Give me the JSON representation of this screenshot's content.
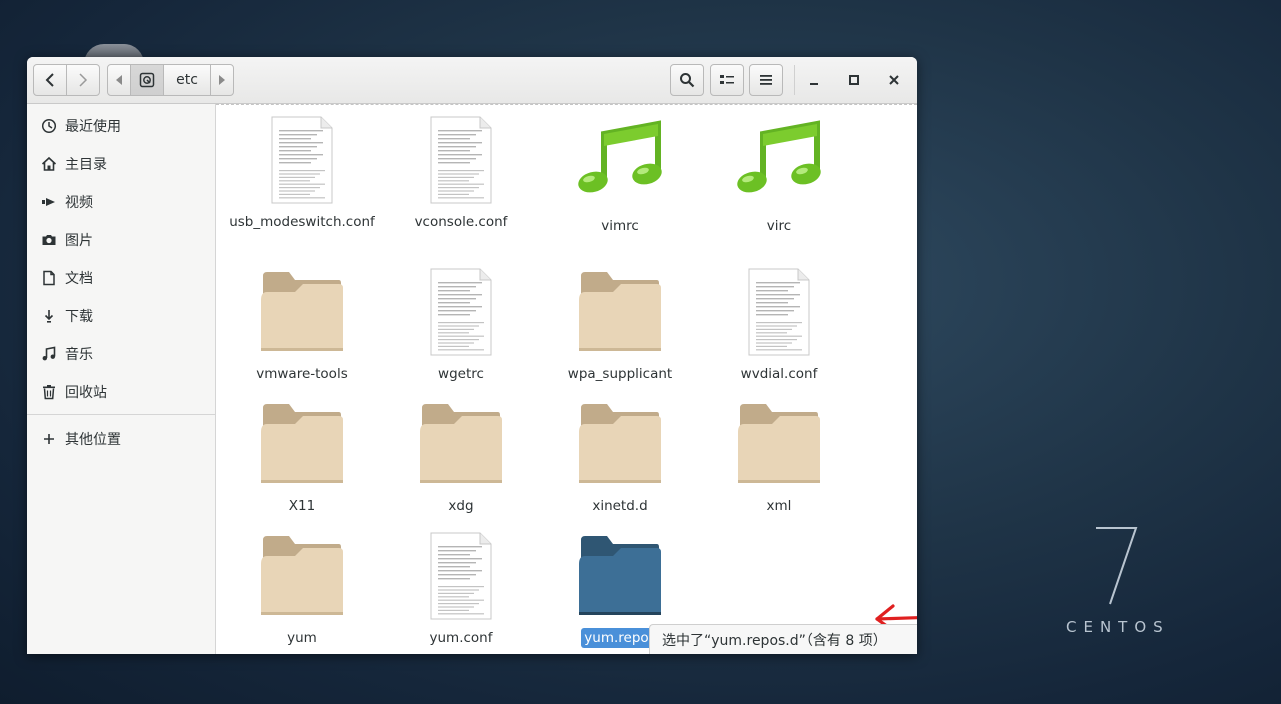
{
  "desktop": {
    "brand_number": "7",
    "brand_text": "CENTOS"
  },
  "toolbar": {
    "path_segment": "etc"
  },
  "sidebar": {
    "items": [
      {
        "label": "最近使用",
        "icon": "clock-icon"
      },
      {
        "label": "主目录",
        "icon": "home-icon"
      },
      {
        "label": "视频",
        "icon": "video-icon"
      },
      {
        "label": "图片",
        "icon": "camera-icon"
      },
      {
        "label": "文档",
        "icon": "document-icon"
      },
      {
        "label": "下载",
        "icon": "download-icon"
      },
      {
        "label": "音乐",
        "icon": "music-icon"
      },
      {
        "label": "回收站",
        "icon": "trash-icon"
      }
    ],
    "other_locations": {
      "label": "其他位置",
      "icon": "plus-icon"
    }
  },
  "files": [
    {
      "name": "usb_modeswitch.conf",
      "type": "text"
    },
    {
      "name": "vconsole.conf",
      "type": "text"
    },
    {
      "name": "vimrc",
      "type": "audio"
    },
    {
      "name": "virc",
      "type": "audio"
    },
    {
      "name": "vmware-tools",
      "type": "folder"
    },
    {
      "name": "wgetrc",
      "type": "text"
    },
    {
      "name": "wpa_supplicant",
      "type": "folder"
    },
    {
      "name": "wvdial.conf",
      "type": "text"
    },
    {
      "name": "X11",
      "type": "folder"
    },
    {
      "name": "xdg",
      "type": "folder"
    },
    {
      "name": "xinetd.d",
      "type": "folder"
    },
    {
      "name": "xml",
      "type": "folder"
    },
    {
      "name": "yum",
      "type": "folder"
    },
    {
      "name": "yum.conf",
      "type": "text"
    },
    {
      "name": "yum.repos",
      "type": "folder-selected"
    }
  ],
  "status": {
    "text": "选中了“yum.repos.d”（含有 8 项）"
  },
  "colors": {
    "folder": "#e8d5b7",
    "folder_tab": "#c1ab8a",
    "selected_folder": "#3d6f96",
    "selection": "#4a90d9",
    "annotation_arrow": "#e02020"
  }
}
